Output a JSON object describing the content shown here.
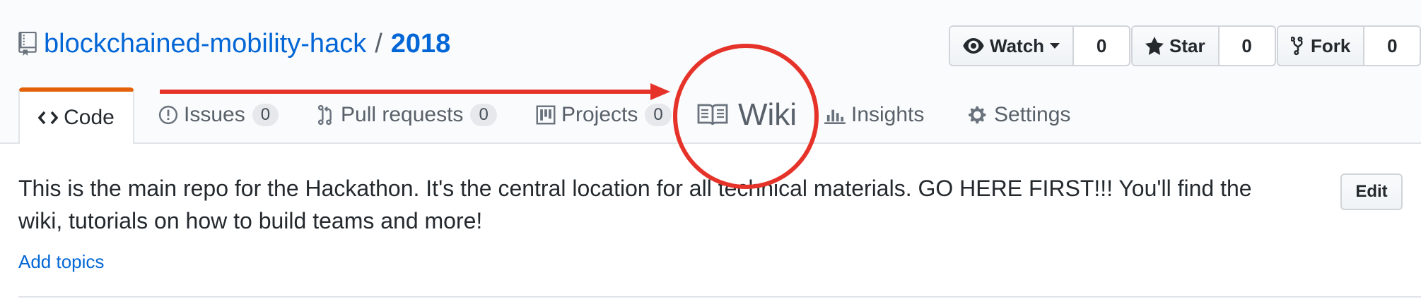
{
  "repo": {
    "owner": "blockchained-mobility-hack",
    "separator": "/",
    "name": "2018",
    "icon": "repo-book-icon"
  },
  "actions": {
    "watch": {
      "label": "Watch",
      "count": "0",
      "icon": "eye-icon"
    },
    "star": {
      "label": "Star",
      "count": "0",
      "icon": "star-icon"
    },
    "fork": {
      "label": "Fork",
      "count": "0",
      "icon": "fork-icon"
    }
  },
  "tabs": [
    {
      "label": "Code",
      "icon": "code-icon",
      "selected": true
    },
    {
      "label": "Issues",
      "count": "0",
      "icon": "issue-icon"
    },
    {
      "label": "Pull requests",
      "count": "0",
      "icon": "pull-request-icon"
    },
    {
      "label": "Projects",
      "count": "0",
      "icon": "project-icon"
    },
    {
      "label": "Wiki",
      "icon": "book-icon",
      "highlighted": true
    },
    {
      "label": "Insights",
      "icon": "graph-icon"
    },
    {
      "label": "Settings",
      "icon": "gear-icon"
    }
  ],
  "description": {
    "text": "This is the main repo for the Hackathon. It's the central location for all technical materials. GO HERE FIRST!!! You'll find the wiki, tutorials on how to build teams and more!",
    "edit_label": "Edit",
    "add_topics": "Add topics"
  },
  "colors": {
    "link": "#0366d6",
    "annotation": "#e6332a",
    "selected_tab_accent": "#e36209"
  }
}
